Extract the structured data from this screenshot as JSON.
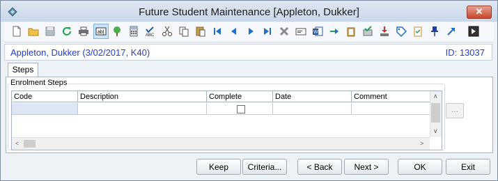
{
  "window": {
    "title": "Future Student Maintenance  [Appleton, Dukker]"
  },
  "toolbar": {
    "icons": [
      "new-icon",
      "open-folder-icon",
      "save-icon",
      "refresh-icon",
      "print-icon",
      "text-field-icon",
      "tree-icon",
      "calculator-icon",
      "spellcheck-icon",
      "cut-icon",
      "copy-icon",
      "paste-icon",
      "first-record-icon",
      "previous-record-icon",
      "next-record-icon",
      "last-record-icon",
      "delete-icon",
      "card-icon",
      "word-document-icon",
      "forward-icon",
      "clipboard-icon",
      "approve-icon",
      "download-icon",
      "tag-icon",
      "checklist-icon",
      "pin-icon",
      "arrow-up-right-icon",
      "exit-icon"
    ]
  },
  "student": {
    "name": "Appleton, Dukker (3/02/2017, K40)",
    "id": "ID: 13037"
  },
  "tabs": [
    {
      "label": "Steps"
    }
  ],
  "enrolment_steps": {
    "group_label": "Enrolment Steps",
    "columns": [
      "Code",
      "Description",
      "Complete",
      "Date",
      "Comment"
    ],
    "rows": [
      {
        "code": "",
        "description": "",
        "complete": false,
        "date": "",
        "comment": ""
      }
    ],
    "ellipsis_label": "..."
  },
  "buttons": {
    "keep": "Keep",
    "criteria": "Criteria...",
    "back": "< Back",
    "next": "Next >",
    "ok": "OK",
    "exit": "Exit"
  }
}
